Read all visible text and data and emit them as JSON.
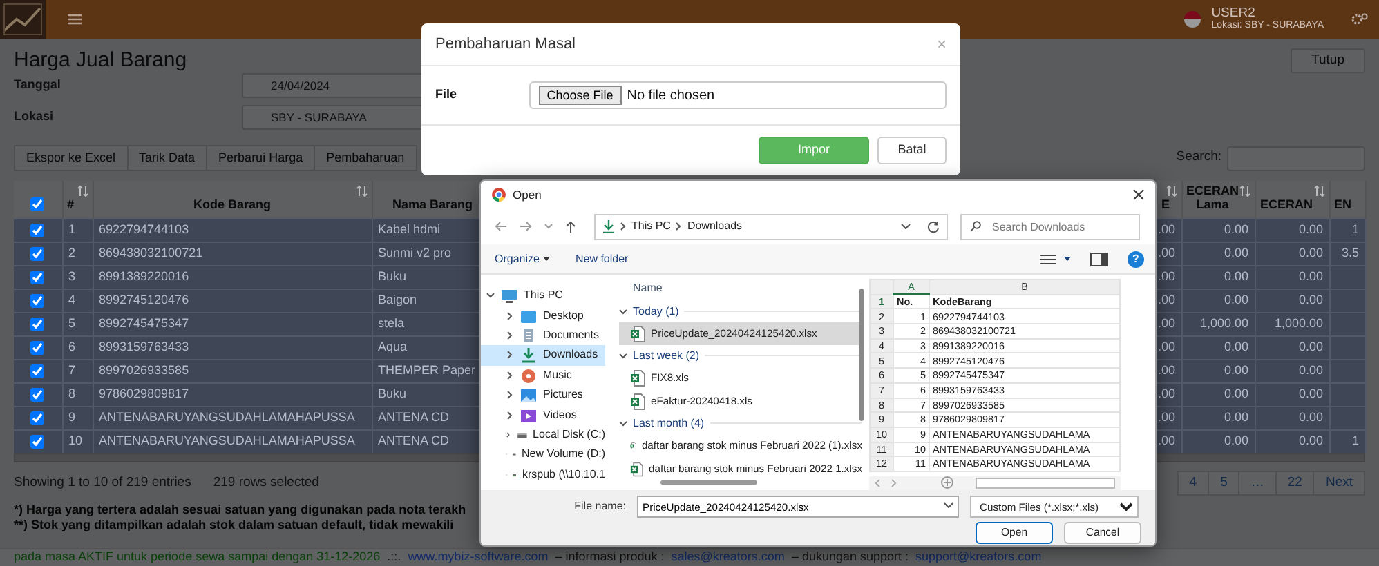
{
  "header": {
    "user": "USER2",
    "location": "Lokasi: SBY - SURABAYA"
  },
  "page": {
    "title": "Harga Jual Barang",
    "close_button": "Tutup",
    "fields": [
      {
        "label": "Tanggal",
        "value": "24/04/2024"
      },
      {
        "label": "Lokasi",
        "value": "SBY - SURABAYA"
      }
    ],
    "toolbar": [
      "Ekspor ke Excel",
      "Tarik Data",
      "Perbarui Harga",
      "Pembaharuan"
    ],
    "search": {
      "label": "Search:"
    }
  },
  "table": {
    "all_checked": true,
    "columns": [
      "#",
      "Kode Barang",
      "Nama Barang",
      "E",
      "ECERAN Lama",
      "ECERAN",
      "EN"
    ],
    "rows": [
      {
        "checked": true,
        "selected": true,
        "no": "1",
        "kode": "6922794744103",
        "nama": "Kabel hdmi",
        "e": ".00",
        "lama": "0.00",
        "eceran": "0.00",
        "en": "1"
      },
      {
        "checked": true,
        "selected": true,
        "no": "2",
        "kode": "869438032100721",
        "nama": "Sunmi v2 pro",
        "e": ".00",
        "lama": "0.00",
        "eceran": "0.00",
        "en": "3.5"
      },
      {
        "checked": true,
        "selected": true,
        "no": "3",
        "kode": "8991389220016",
        "nama": "Buku",
        "e": ".00",
        "lama": "0.00",
        "eceran": "0.00"
      },
      {
        "checked": true,
        "selected": true,
        "no": "4",
        "kode": "8992745120476",
        "nama": "Baigon",
        "e": ".00",
        "lama": "0.00",
        "eceran": "0.00"
      },
      {
        "checked": true,
        "selected": true,
        "no": "5",
        "kode": "8992745475347",
        "nama": "stela",
        "e": ".00",
        "lama": "1,000.00",
        "eceran": "1,000.00"
      },
      {
        "checked": true,
        "selected": true,
        "no": "6",
        "kode": "8993159763433",
        "nama": "Aqua",
        "e": ".00",
        "lama": "0.00",
        "eceran": "0.00"
      },
      {
        "checked": true,
        "selected": true,
        "no": "7",
        "kode": "8997026933585",
        "nama": "THEMPER Paper",
        "e": ".00",
        "lama": "0.00",
        "eceran": "0.00"
      },
      {
        "checked": true,
        "selected": true,
        "no": "8",
        "kode": "9786029809817",
        "nama": "Buku",
        "e": ".00",
        "lama": "0.00",
        "eceran": "0.00"
      },
      {
        "checked": true,
        "selected": true,
        "no": "9",
        "kode": "ANTENABARUYANGSUDAHLAMAHAPUSSA",
        "nama": "ANTENA CD",
        "e": ".00",
        "lama": "0.00",
        "eceran": "0.00"
      },
      {
        "checked": true,
        "selected": true,
        "no": "10",
        "kode": "ANTENABARUYANGSUDAHLAMAHAPUSSA",
        "nama": "ANTENA CD",
        "e": ".00",
        "lama": "0.00",
        "eceran": "0.00",
        "en": "1"
      }
    ]
  },
  "info": "Showing 1 to 10 of 219 entries",
  "selected_info": "219 rows selected",
  "pagination": [
    "4",
    "5",
    "…",
    "22",
    "Next"
  ],
  "notes": [
    "*) Harga yang tertera adalah sesuai satuan yang digunakan pada nota terakh",
    "**) Stok yang ditampilkan adalah stok dalam satuan default, tidak mewakili"
  ],
  "footer": [
    {
      "kind": "status",
      "text": "pada masa AKTIF untuk periode sewa sampai dengan 31-12-2026"
    },
    {
      "kind": "text",
      "text": ".::."
    },
    {
      "kind": "link",
      "text": "www.mybiz-software.com"
    },
    {
      "kind": "text",
      "text": "– informasi produk :"
    },
    {
      "kind": "link",
      "text": "sales@kreators.com"
    },
    {
      "kind": "text",
      "text": "– dukungan support :"
    },
    {
      "kind": "link",
      "text": "support@kreators.com"
    }
  ],
  "modal": {
    "title": "Pembaharuan Masal",
    "close": "×",
    "file_label": "File",
    "choose_button": "Choose File",
    "file_status": "No file chosen",
    "buttons": [
      {
        "kind": "primary",
        "label": "Impor"
      },
      {
        "kind": "default",
        "label": "Batal"
      }
    ]
  },
  "open_dialog": {
    "title": "Open",
    "path": [
      "This PC",
      "Downloads"
    ],
    "search_placeholder": "Search Downloads",
    "toolbar": {
      "organize": "Organize",
      "new_folder": "New folder",
      "help": "?"
    },
    "tree": [
      {
        "label": "This PC",
        "kind": "pc",
        "expanded": true,
        "selected": false,
        "children": [
          {
            "label": "Desktop",
            "kind": "desktop",
            "expanded": false,
            "selected": false
          },
          {
            "label": "Documents",
            "kind": "documents",
            "expanded": false,
            "selected": false
          },
          {
            "label": "Downloads",
            "kind": "downloads",
            "expanded": false,
            "selected": true
          },
          {
            "label": "Music",
            "kind": "music",
            "expanded": false,
            "selected": false
          },
          {
            "label": "Pictures",
            "kind": "pictures",
            "expanded": false,
            "selected": false
          },
          {
            "label": "Videos",
            "kind": "videos",
            "expanded": false,
            "selected": false
          },
          {
            "label": "Local Disk (C:)",
            "kind": "disk",
            "expanded": false,
            "selected": false
          },
          {
            "label": "New Volume (D:)",
            "kind": "disk",
            "expanded": false,
            "selected": false
          },
          {
            "label": "krspub (\\\\10.10.1",
            "kind": "network",
            "expanded": false,
            "selected": false
          }
        ]
      }
    ],
    "list_header": "Name",
    "groups": [
      {
        "label": "Today (1)",
        "expanded": true,
        "files": [
          {
            "name": "PriceUpdate_20240424125420.xlsx",
            "selected": true
          }
        ]
      },
      {
        "label": "Last week (2)",
        "expanded": true,
        "files": [
          {
            "name": "FIX8.xls",
            "selected": false
          },
          {
            "name": "eFaktur-20240418.xls",
            "selected": false
          }
        ]
      },
      {
        "label": "Last month (4)",
        "expanded": true,
        "files": [
          {
            "name": "daftar barang stok minus Februari 2022 (1).xlsx",
            "selected": false
          },
          {
            "name": "daftar barang stok minus Februari 2022 1.xlsx",
            "selected": false
          }
        ]
      }
    ],
    "preview": {
      "columns": [
        {
          "label": "A",
          "selected": true
        },
        {
          "label": "B",
          "selected": false
        }
      ],
      "rows": [
        {
          "n": "1",
          "a": "No.",
          "b": "KodeBarang",
          "selected": true
        },
        {
          "n": "2",
          "a": "1",
          "b": "6922794744103",
          "selected": false
        },
        {
          "n": "3",
          "a": "2",
          "b": "869438032100721",
          "selected": false
        },
        {
          "n": "4",
          "a": "3",
          "b": "8991389220016",
          "selected": false
        },
        {
          "n": "5",
          "a": "4",
          "b": "8992745120476",
          "selected": false
        },
        {
          "n": "6",
          "a": "5",
          "b": "8992745475347",
          "selected": false
        },
        {
          "n": "7",
          "a": "6",
          "b": "8993159763433",
          "selected": false
        },
        {
          "n": "8",
          "a": "7",
          "b": "8997026933585",
          "selected": false
        },
        {
          "n": "9",
          "a": "8",
          "b": "9786029809817",
          "selected": false
        },
        {
          "n": "10",
          "a": "9",
          "b": "ANTENABARUYANGSUDAHLAMA",
          "selected": false
        },
        {
          "n": "11",
          "a": "10",
          "b": "ANTENABARUYANGSUDAHLAMA",
          "selected": false
        },
        {
          "n": "12",
          "a": "11",
          "b": "ANTENABARUYANGSUDAHLAMA",
          "selected": false
        }
      ]
    },
    "file_name_label": "File name:",
    "file_name": "PriceUpdate_20240424125420.xlsx",
    "file_type": "Custom Files (*.xlsx;*.xls)",
    "buttons": [
      "Open",
      "Cancel"
    ]
  }
}
